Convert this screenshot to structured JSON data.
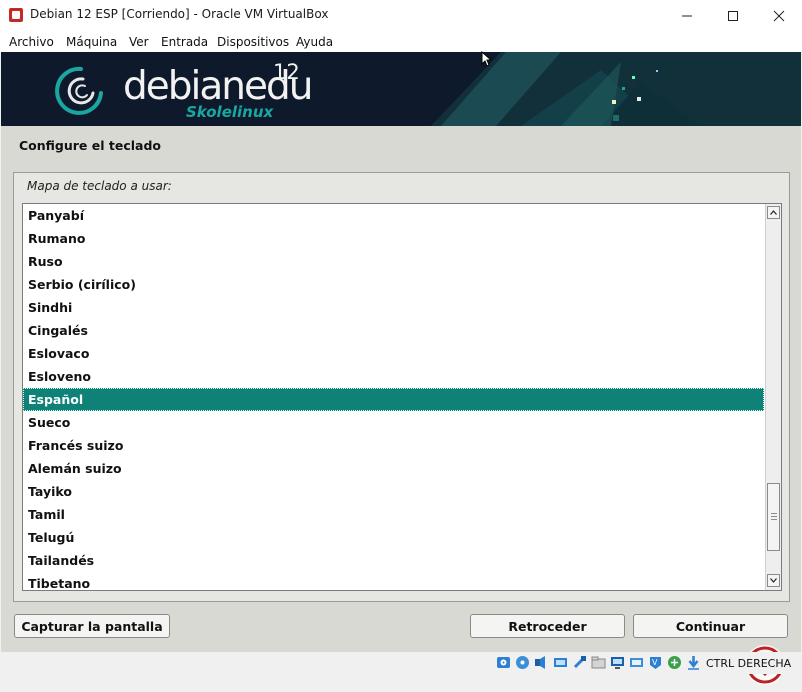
{
  "window": {
    "title": "Debian 12 ESP [Corriendo] - Oracle VM VirtualBox",
    "icon": "virtualbox-vm-icon"
  },
  "menu": [
    "Archivo",
    "Máquina",
    "Ver",
    "Entrada",
    "Dispositivos",
    "Ayuda"
  ],
  "banner": {
    "brand": "debianedu",
    "version": "12",
    "subtitle": "Skolelinux"
  },
  "installer": {
    "title": "Configure el teclado",
    "list_label": "Mapa de teclado a usar:",
    "items": [
      "Panyabí",
      "Rumano",
      "Ruso",
      "Serbio (cirílico)",
      "Sindhi",
      "Cingalés",
      "Eslovaco",
      "Esloveno",
      "Español",
      "Sueco",
      "Francés suizo",
      "Alemán suizo",
      "Tayiko",
      "Tamil",
      "Telugú",
      "Tailandés",
      "Tibetano"
    ],
    "selected": "Español",
    "buttons": {
      "screenshot": "Capturar la pantalla",
      "back": "Retroceder",
      "continue": "Continuar"
    }
  },
  "statusbar": {
    "host_key": "CTRL DERECHA",
    "icons": [
      "hard-disk-icon",
      "optical-drive-icon",
      "audio-icon",
      "network-icon",
      "usb-icon",
      "shared-folders-icon",
      "display-icon",
      "video-capture-icon",
      "recording-icon",
      "vbox-network-icon",
      "download-arrow-icon"
    ]
  },
  "colors": {
    "selection": "#0f8278",
    "banner_bg": "#0e1a2b",
    "accent_teal": "#1aa7a0"
  }
}
